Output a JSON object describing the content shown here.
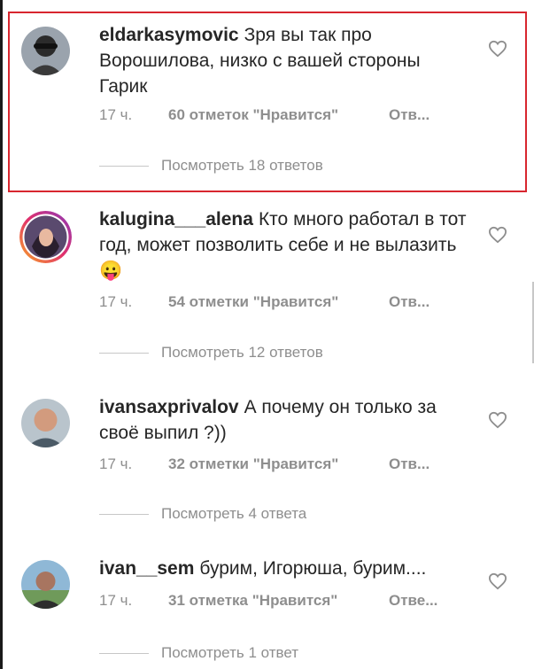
{
  "comments": [
    {
      "username": "eldarkasymovic",
      "text": "Зря вы так про Ворошилова, низко с вашей стороны Гарик",
      "time": "17 ч.",
      "likes": "60 отметок \"Нравится\"",
      "reply": "Отв...",
      "view_replies": "Посмотреть 18 ответов",
      "highlighted": true
    },
    {
      "username": "kalugina___alena",
      "text": "Кто много работал в тот год, может позволить себе и не вылазить 😛",
      "time": "17 ч.",
      "likes": "54 отметки \"Нравится\"",
      "reply": "Отв...",
      "view_replies": "Посмотреть 12 ответов"
    },
    {
      "username": "ivansaxprivalov",
      "text": "А почему он только за своё выпил ?))",
      "time": "17 ч.",
      "likes": "32 отметки \"Нравится\"",
      "reply": "Отв...",
      "view_replies": "Посмотреть 4 ответа"
    },
    {
      "username": "ivan__sem",
      "text": "бурим, Игорюша, бурим....",
      "time": "17 ч.",
      "likes": "31 отметка \"Нравится\"",
      "reply": "Отве...",
      "view_replies": "Посмотреть 1 ответ"
    }
  ],
  "colors": {
    "highlight_border": "#d8262f",
    "secondary_text": "#8e8e8e",
    "primary_text": "#262626"
  },
  "icons": {
    "like": "heart-outline-icon",
    "avatar": "user-avatar"
  }
}
